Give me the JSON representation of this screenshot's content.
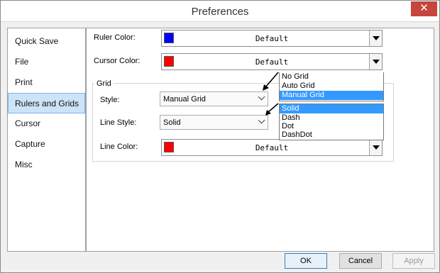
{
  "window": {
    "title": "Preferences",
    "close_glyph": "✕"
  },
  "sidebar": {
    "items": [
      {
        "label": "Quick Save",
        "selected": false
      },
      {
        "label": "File",
        "selected": false
      },
      {
        "label": "Print",
        "selected": false
      },
      {
        "label": "Rulers and Grids",
        "selected": true
      },
      {
        "label": "Cursor",
        "selected": false
      },
      {
        "label": "Capture",
        "selected": false
      },
      {
        "label": "Misc",
        "selected": false
      }
    ]
  },
  "rulers": {
    "ruler_color_label": "Ruler Color:",
    "ruler_color_value": "Default",
    "ruler_color_swatch": "#0000ff",
    "cursor_color_label": "Cursor Color:",
    "cursor_color_value": "Default",
    "cursor_color_swatch": "#ff0000"
  },
  "grid": {
    "group_title": "Grid",
    "style_label": "Style:",
    "style_value": "Manual Grid",
    "style_options": [
      "No Grid",
      "Auto Grid",
      "Manual Grid"
    ],
    "style_selected_index": 2,
    "line_style_label": "Line Style:",
    "line_style_value": "Solid",
    "line_style_options": [
      "Solid",
      "Dash",
      "Dot",
      "DashDot"
    ],
    "line_style_selected_index": 0,
    "line_color_label": "Line Color:",
    "line_color_value": "Default",
    "line_color_swatch": "#ff0000"
  },
  "footer": {
    "ok_label": "OK",
    "cancel_label": "Cancel",
    "apply_label": "Apply"
  },
  "colors": {
    "selection_highlight": "#3399ff",
    "sidebar_selected": "#cce4f7",
    "close_button": "#c7453b"
  }
}
